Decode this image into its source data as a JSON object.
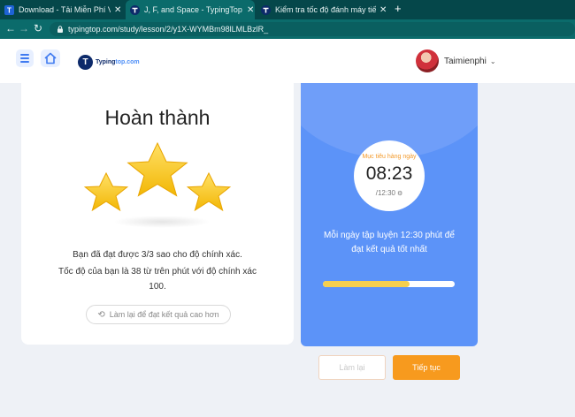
{
  "browser": {
    "tabs": [
      {
        "title": "Download - Tải Miễn Phí VN - Ph",
        "active": false,
        "icon": "t-icon"
      },
      {
        "title": "J, F, and Space - TypingTop",
        "active": true,
        "icon": "typingtop-icon"
      },
      {
        "title": "Kiểm tra tốc độ đánh máy tiếng V",
        "active": false,
        "icon": "typingtop-icon"
      }
    ],
    "url": "typingtop.com/study/lesson/2/y1X-WYMBm98lLMLBzlR_"
  },
  "header": {
    "logo_text": "Typing",
    "logo_suffix": "top.com",
    "user_name": "Taimienphi"
  },
  "result": {
    "title": "Hoàn thành",
    "stars_earned": 3,
    "stars_total": 3,
    "line1": "Bạn đã đạt được 3/3 sao cho độ chính xác.",
    "line2": "Tốc độ của bạn là 38 từ trên phút với độ chính xác",
    "line3": "100.",
    "retry_best_label": "Làm lại để đạt kết quả cao hơn"
  },
  "goal": {
    "label": "Mục tiêu hàng ngày",
    "time": "08:23",
    "target": "/12:30",
    "message_line1": "Mỗi ngày tập luyện 12:30 phút để",
    "message_line2": "đạt kết quả tốt nhất",
    "progress_fraction": 0.66
  },
  "actions": {
    "retry_label": "Làm lại",
    "next_label": "Tiếp tục"
  },
  "colors": {
    "browser_dark": "#05474a",
    "browser_active": "#0b6b6b",
    "goal_panel": "#5c93f8",
    "star": "#f5c518",
    "accent_orange": "#f79a1e",
    "progress_fill": "#f5cf4e"
  }
}
